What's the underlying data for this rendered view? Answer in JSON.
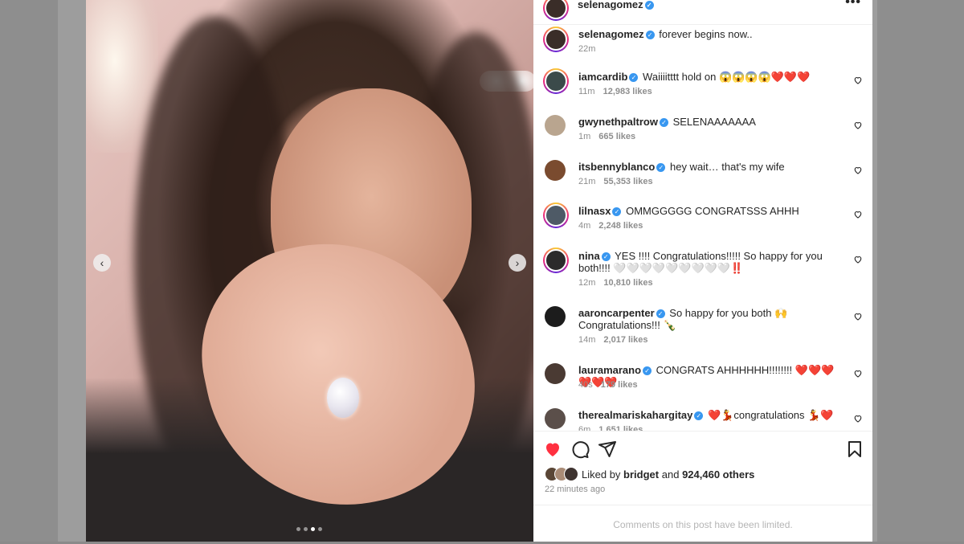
{
  "post": {
    "username": "selenagomez",
    "caption": "forever begins now..",
    "caption_time": "22m",
    "more_label": "•••"
  },
  "media": {
    "prev_label": "‹",
    "next_label": "›",
    "slide_count": 4,
    "active_slide": 3
  },
  "comments": [
    {
      "user": "iamcardib",
      "verified": true,
      "text": "Waiiiitttt hold on 😱😱😱😱❤️❤️❤️",
      "time": "11m",
      "likes": "12,983 likes",
      "avatar_color": "#3b4a4a",
      "story_ring": true
    },
    {
      "user": "gwynethpaltrow",
      "verified": true,
      "text": "SELENAAAAAAA",
      "time": "1m",
      "likes": "665 likes",
      "avatar_color": "#b9a58f",
      "story_ring": false
    },
    {
      "user": "itsbennyblanco",
      "verified": true,
      "text": "hey wait… that's my wife",
      "time": "21m",
      "likes": "55,353 likes",
      "avatar_color": "#7a4b2f",
      "story_ring": false
    },
    {
      "user": "lilnasx",
      "verified": true,
      "text": "OMMGGGGG CONGRATSSS AHHH",
      "time": "4m",
      "likes": "2,248 likes",
      "avatar_color": "#4e5a66",
      "story_ring": true
    },
    {
      "user": "nina",
      "verified": true,
      "text": "YES !!!! Congratulations!!!!! So happy for you both!!!! 🤍🤍🤍🤍🤍🤍🤍🤍🤍‼️",
      "time": "12m",
      "likes": "10,810 likes",
      "avatar_color": "#2b2b2b",
      "story_ring": true
    },
    {
      "user": "aaroncarpenter",
      "verified": true,
      "text": "So happy for you both 🙌 Congratulations!!! 🍾",
      "time": "14m",
      "likes": "2,017 likes",
      "avatar_color": "#1c1c1c",
      "story_ring": false
    },
    {
      "user": "lauramarano",
      "verified": true,
      "text": "CONGRATS AHHHHHH!!!!!!!! ❤️❤️❤️❤️❤️❤️",
      "time": "40s",
      "likes": "179 likes",
      "avatar_color": "#4a3a33",
      "story_ring": false
    },
    {
      "user": "therealmariskahargitay",
      "verified": true,
      "text": "❤️💃congratulations 💃❤️",
      "time": "6m",
      "likes": "1,651 likes",
      "avatar_color": "#5b4f4a",
      "story_ring": false
    }
  ],
  "actions": {
    "liked_prefix": "Liked by",
    "liked_user": "bridget",
    "liked_and": "and",
    "liked_others": "924,460 others",
    "time_ago": "22 minutes ago",
    "limited_notice": "Comments on this post have been limited."
  },
  "colors": {
    "heart_liked": "#ff3040",
    "verified": "#3897f0",
    "secondary_text": "#8e8e8e"
  },
  "icons": [
    "heart-icon",
    "comment-icon",
    "share-icon",
    "bookmark-icon",
    "more-options-icon",
    "verified-badge-icon"
  ]
}
